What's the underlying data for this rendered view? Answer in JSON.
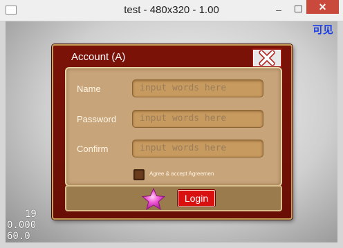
{
  "window": {
    "title": "test - 480x320 - 1.00",
    "min_glyph": "–",
    "close_glyph": "✕"
  },
  "overlay": {
    "visible_label": "可见",
    "stats": [
      "19",
      "0.000",
      "60.0"
    ]
  },
  "dialog": {
    "title": "Account (A)",
    "close_icon": "close-x-icon",
    "fields": [
      {
        "label": "Name",
        "placeholder": "input words here"
      },
      {
        "label": "Password",
        "placeholder": "input words here"
      },
      {
        "label": "Confirm",
        "placeholder": "input words here"
      }
    ],
    "agree_text": "Agree & accept Agreemen",
    "agree_checked": false,
    "star_icon": "star-icon",
    "login_label": "Login"
  },
  "colors": {
    "dialog_red": "#7b1208",
    "panel_tan": "#c8a47b",
    "login_red": "#d81010",
    "label_blue": "#1b3de8",
    "star_pink": "#e83ec9"
  }
}
